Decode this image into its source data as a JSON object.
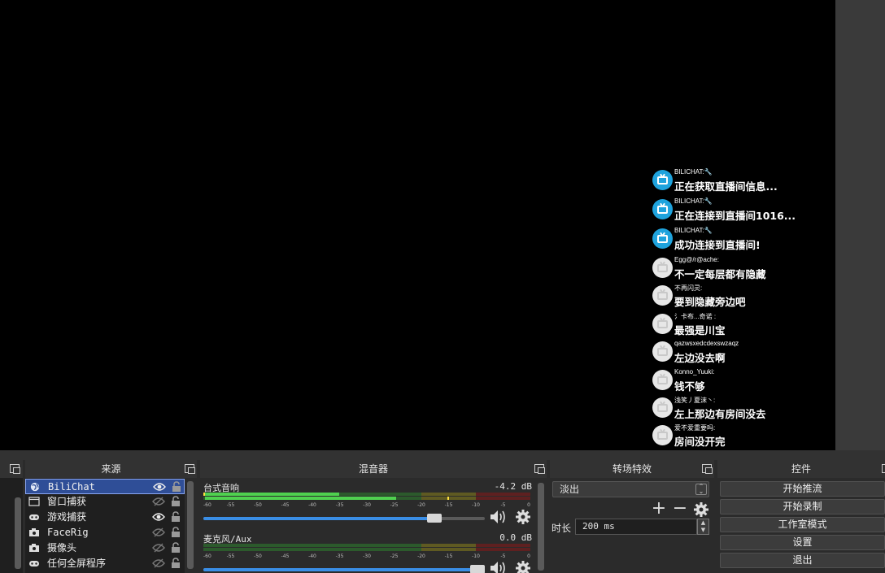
{
  "preview": {
    "chat_messages": [
      {
        "name": "BILICHAT:🔧",
        "text": "正在获取直播间信息...",
        "avatar": "bilibili-tv-blue"
      },
      {
        "name": "BILICHAT:🔧",
        "text": "正在连接到直播间1016...",
        "avatar": "bilibili-tv-blue"
      },
      {
        "name": "BILICHAT:🔧",
        "text": "成功连接到直播间!",
        "avatar": "bilibili-tv-blue"
      },
      {
        "name": "Egg@/r@ache:",
        "text": "不一定每层都有隐藏",
        "avatar": "bilibili-tv-gray"
      },
      {
        "name": "不再闪灵:",
        "text": "要到隐藏旁边吧",
        "avatar": "bilibili-tv-gray"
      },
      {
        "name": "氵卡布...奇诺 :",
        "text": "最强是川宝",
        "avatar": "bilibili-tv-gray"
      },
      {
        "name": "qazwsxedcdexswzaqz",
        "text": "左边没去啊",
        "avatar": "bilibili-tv-gray"
      },
      {
        "name": "Konno_Yuuki:",
        "text": "钱不够",
        "avatar": "bilibili-tv-gray"
      },
      {
        "name": "浅笑丿夏沫丶:",
        "text": "左上那边有房间没去",
        "avatar": "bilibili-tv-gray"
      },
      {
        "name": "爱不爱重要吗:",
        "text": "房间没开完",
        "avatar": "bilibili-tv-gray"
      }
    ]
  },
  "sources": {
    "title": "来源",
    "items": [
      {
        "label": "BiliChat",
        "icon": "browser-globe-icon",
        "visible": true,
        "selected": true
      },
      {
        "label": "窗口捕获",
        "icon": "window-icon",
        "visible": false,
        "selected": false
      },
      {
        "label": "游戏捕获",
        "icon": "gamepad-icon",
        "visible": true,
        "selected": false
      },
      {
        "label": "FaceRig",
        "icon": "camera-icon",
        "visible": false,
        "selected": false
      },
      {
        "label": "摄像头",
        "icon": "camera-icon",
        "visible": false,
        "selected": false
      },
      {
        "label": "任何全屏程序",
        "icon": "gamepad-icon",
        "visible": false,
        "selected": false
      }
    ]
  },
  "mixer": {
    "title": "混音器",
    "ticks": [
      "-60",
      "-55",
      "-50",
      "-45",
      "-40",
      "-35",
      "-30",
      "-25",
      "-20",
      "-15",
      "-10",
      "-5",
      "0"
    ],
    "channels": [
      {
        "name": "台式音响",
        "db": "-4.2 dB",
        "level": 0.82
      },
      {
        "name": "麦克风/Aux",
        "db": "0.0 dB",
        "level": 1.0
      }
    ]
  },
  "transitions": {
    "title": "转场特效",
    "selected": "淡出",
    "duration_label": "时长",
    "duration_value": "200 ms"
  },
  "controls": {
    "title": "控件",
    "buttons": [
      "开始推流",
      "开始录制",
      "工作室模式",
      "设置",
      "退出"
    ]
  },
  "colors": {
    "accent": "#3a8ee6",
    "selection": "#2f4e97",
    "meter_green": "#4fd14f",
    "meter_yellow": "#d6c54a",
    "meter_red": "#c94040",
    "bili_blue": "#1fa3dd"
  }
}
